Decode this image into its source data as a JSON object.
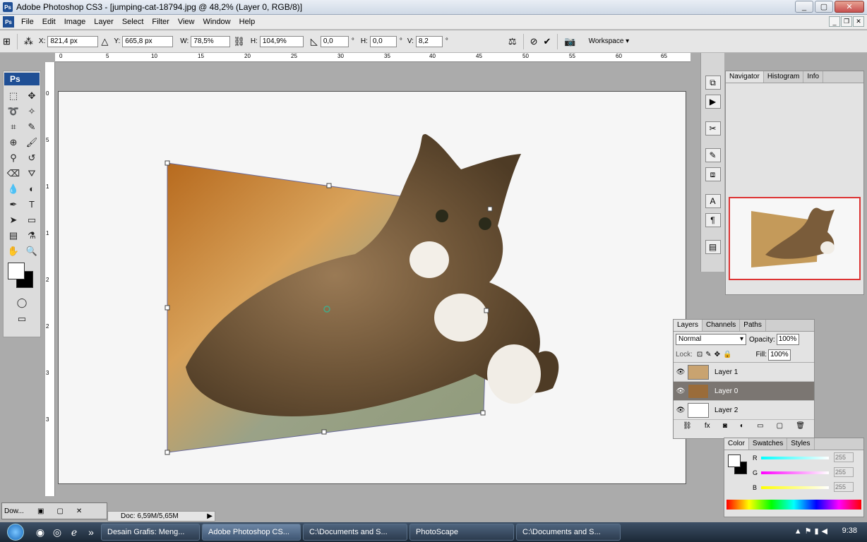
{
  "window": {
    "title": "Adobe Photoshop CS3 - [jumping-cat-18794.jpg @ 48,2% (Layer 0, RGB/8)]",
    "app_icon": "Ps"
  },
  "menu": [
    "File",
    "Edit",
    "Image",
    "Layer",
    "Select",
    "Filter",
    "View",
    "Window",
    "Help"
  ],
  "options": {
    "x_label": "X:",
    "x": "821,4 px",
    "y_label": "Y:",
    "y": "665,8 px",
    "w_label": "W:",
    "w": "78,5%",
    "h_label": "H:",
    "h": "104,9%",
    "rot": "0,0",
    "rot_unit": "°",
    "hskew_label": "H:",
    "hskew": "0,0",
    "hskew_unit": "°",
    "vskew_label": "V:",
    "vskew": "8,2",
    "vskew_unit": "°",
    "workspace": "Workspace ▾"
  },
  "ruler_top": [
    "0",
    "5",
    "10",
    "15",
    "20",
    "25",
    "30",
    "35",
    "40",
    "45",
    "50",
    "55",
    "60",
    "65"
  ],
  "ruler_left": [
    "0",
    "5",
    "1",
    "1",
    "2",
    "2",
    "3",
    "3"
  ],
  "toolbox": {
    "logo": "Ps"
  },
  "status": {
    "doc": "Doc: 6,59M/5,65M",
    "mini_title": "Dow..."
  },
  "navigator_tabs": [
    "Navigator",
    "Histogram",
    "Info"
  ],
  "layers_panel": {
    "tabs": [
      "Layers",
      "Channels",
      "Paths"
    ],
    "blend_mode": "Normal",
    "opacity_label": "Opacity:",
    "opacity": "100%",
    "lock_label": "Lock:",
    "fill_label": "Fill:",
    "fill": "100%",
    "layers": [
      {
        "name": "Layer 1"
      },
      {
        "name": "Layer 0"
      },
      {
        "name": "Layer 2"
      }
    ]
  },
  "color_panel": {
    "tabs": [
      "Color",
      "Swatches",
      "Styles"
    ],
    "r_label": "R",
    "g_label": "G",
    "b_label": "B",
    "r": "255",
    "g": "255",
    "b": "255"
  },
  "taskbar": {
    "items": [
      "Desain Grafis: Meng...",
      "Adobe Photoshop CS...",
      "C:\\Documents and S...",
      "PhotoScape",
      "C:\\Documents and S..."
    ],
    "clock": "9:38"
  },
  "colors": {
    "nav_frame": "#dd3333",
    "selected_layer": "#7b7672",
    "titlebar": "#cfd9e6"
  }
}
